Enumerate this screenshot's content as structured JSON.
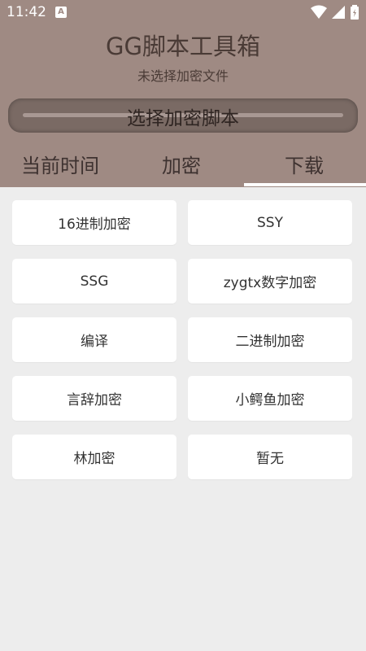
{
  "status_bar": {
    "time": "11:42",
    "badge": "A",
    "icons": [
      "wifi-icon",
      "signal-icon",
      "battery-icon"
    ]
  },
  "header": {
    "title": "GG脚本工具箱",
    "subtitle": "未选择加密文件",
    "select_button": "选择加密脚本",
    "background_color": "#9f8a83"
  },
  "tabs": [
    {
      "label": "当前时间"
    },
    {
      "label": "加密"
    },
    {
      "label": "下载",
      "selected": true
    }
  ],
  "buttons": [
    {
      "label": "16进制加密"
    },
    {
      "label": "SSY"
    },
    {
      "label": "SSG"
    },
    {
      "label": "zygtx数字加密"
    },
    {
      "label": "编译"
    },
    {
      "label": "二进制加密"
    },
    {
      "label": "言辞加密"
    },
    {
      "label": "小鳄鱼加密"
    },
    {
      "label": "林加密"
    },
    {
      "label": "暂无"
    }
  ]
}
